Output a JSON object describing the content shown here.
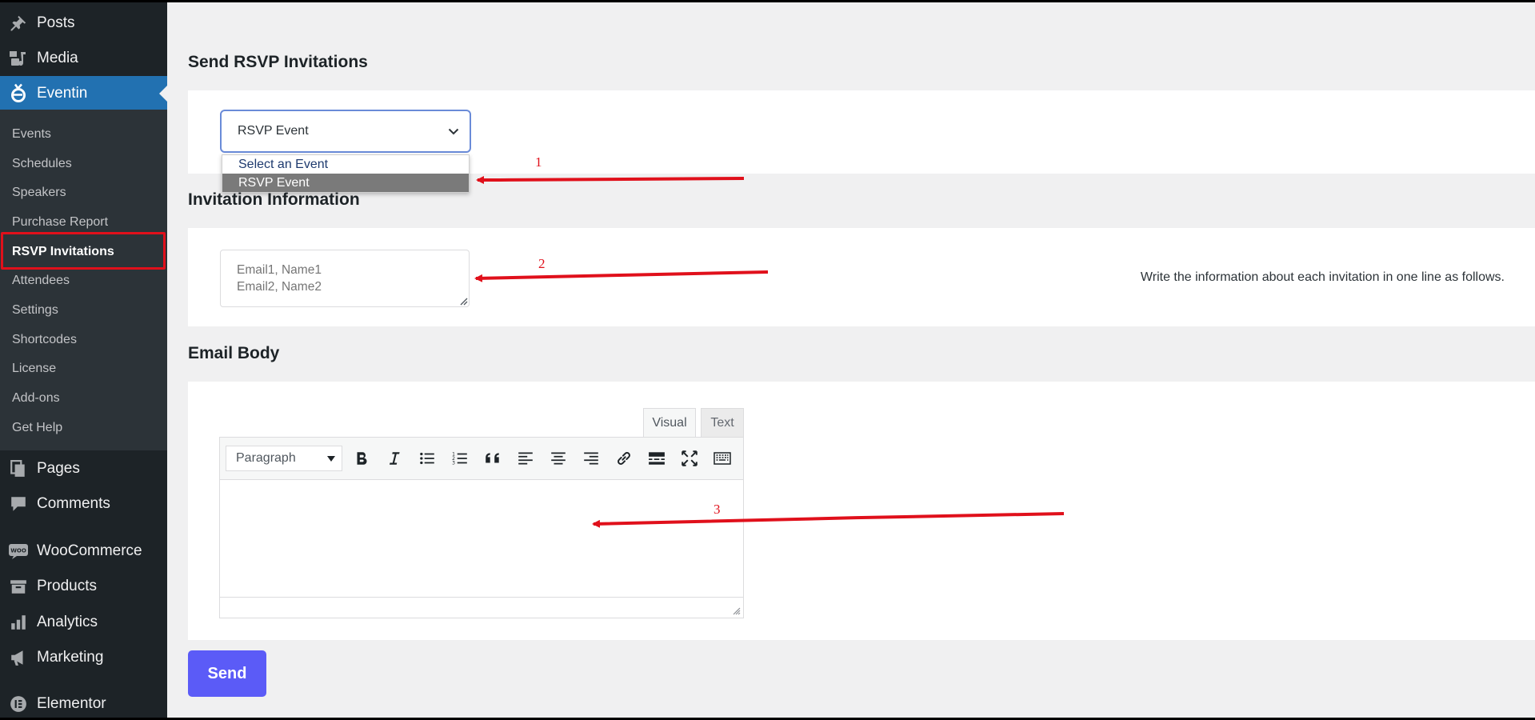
{
  "sidebar": {
    "top_items": [
      {
        "label": "Posts",
        "icon": "pushpin-icon"
      },
      {
        "label": "Media",
        "icon": "media-icon"
      },
      {
        "label": "Eventin",
        "icon": "eventin-icon",
        "active": true
      }
    ],
    "submenu": [
      {
        "label": "Events"
      },
      {
        "label": "Schedules"
      },
      {
        "label": "Speakers"
      },
      {
        "label": "Purchase Report"
      },
      {
        "label": "RSVP Invitations",
        "current": true
      },
      {
        "label": "Attendees"
      },
      {
        "label": "Settings"
      },
      {
        "label": "Shortcodes"
      },
      {
        "label": "License"
      },
      {
        "label": "Add-ons"
      },
      {
        "label": "Get Help"
      }
    ],
    "bottom_items": [
      {
        "label": "Pages",
        "icon": "pages-icon"
      },
      {
        "label": "Comments",
        "icon": "comments-icon"
      },
      {
        "label": "WooCommerce",
        "icon": "woocommerce-icon"
      },
      {
        "label": "Products",
        "icon": "archive-icon"
      },
      {
        "label": "Analytics",
        "icon": "bar-chart-icon"
      },
      {
        "label": "Marketing",
        "icon": "megaphone-icon"
      },
      {
        "label": "Elementor",
        "icon": "elementor-icon"
      }
    ],
    "colors": {
      "bg": "#1d2327",
      "submenu_bg": "#2c3338",
      "active": "#2271b1"
    }
  },
  "rsvp": {
    "title": "Send RSVP Invitations",
    "select": {
      "value": "RSVP Event",
      "options": [
        "Select an Event",
        "RSVP Event"
      ]
    }
  },
  "invitation": {
    "title": "Invitation Information",
    "placeholder": "Email1, Name1\nEmail2, Name2",
    "help": "Write the information about each invitation in one line as follows."
  },
  "email": {
    "title": "Email Body",
    "tabs": [
      "Visual",
      "Text"
    ],
    "format": "Paragraph",
    "toolbar_icons": [
      "bold-icon",
      "italic-icon",
      "bullet-list-icon",
      "numbered-list-icon",
      "blockquote-icon",
      "align-left-icon",
      "align-center-icon",
      "align-right-icon",
      "link-icon",
      "read-more-icon",
      "fullscreen-icon",
      "keyboard-icon"
    ]
  },
  "send_label": "Send",
  "annotations": [
    "1",
    "2",
    "3"
  ],
  "colors": {
    "accent": "#5b5bf7",
    "annotation": "#e0101b"
  }
}
